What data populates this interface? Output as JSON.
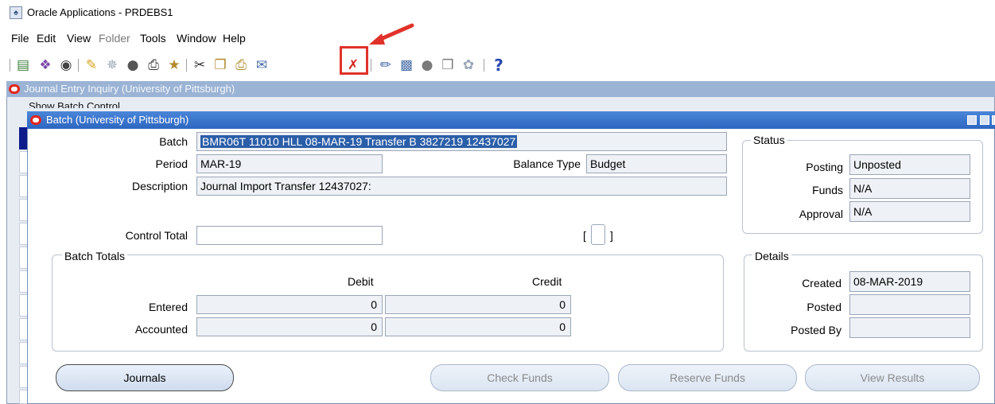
{
  "window": {
    "title": "Oracle Applications - PRDEBS1"
  },
  "menu": {
    "file": "File",
    "edit": "Edit",
    "view": "View",
    "folder": "Folder",
    "tools": "Tools",
    "window": "Window",
    "help": "Help"
  },
  "toolbar": {
    "icons": [
      "new-record-icon",
      "find-icon",
      "show-navigator-icon",
      "save-icon",
      "next-step-icon",
      "switch-responsibility-icon",
      "print-icon",
      "close-form-icon",
      "cut-icon",
      "copy-icon",
      "paste-icon",
      "clear-record-icon",
      "delete-record-icon",
      "edit-field-icon",
      "zoom-icon",
      "translations-icon",
      "attachments-icon",
      "folder-tools-icon",
      "help-icon"
    ],
    "highlighted": "delete-record-icon",
    "help_glyph": "?"
  },
  "bg_window": {
    "title": "Journal Entry Inquiry (University of Pittsburgh)",
    "show_batch_control": "Show Batch Control"
  },
  "batch_window": {
    "title": "Batch (University of Pittsburgh)",
    "batch_label": "Batch",
    "batch_value": "BMR06T 11010 HLL 08-MAR-19 Transfer B 3827219 12437027",
    "period_label": "Period",
    "period_value": "MAR-19",
    "balance_type_label": "Balance Type",
    "balance_type_value": "Budget",
    "description_label": "Description",
    "description_value": "Journal Import Transfer 12437027:",
    "control_total_label": "Control Total",
    "control_total_value": "",
    "dff_open": "[",
    "dff_close": "]",
    "status": {
      "title": "Status",
      "posting_label": "Posting",
      "posting_value": "Unposted",
      "funds_label": "Funds",
      "funds_value": "N/A",
      "approval_label": "Approval",
      "approval_value": "N/A"
    },
    "batch_totals": {
      "title": "Batch Totals",
      "debit_header": "Debit",
      "credit_header": "Credit",
      "entered_label": "Entered",
      "entered_debit": "0",
      "entered_credit": "0",
      "accounted_label": "Accounted",
      "accounted_debit": "0",
      "accounted_credit": "0"
    },
    "details": {
      "title": "Details",
      "created_label": "Created",
      "created_value": "08-MAR-2019",
      "posted_label": "Posted",
      "posted_value": "",
      "posted_by_label": "Posted By",
      "posted_by_value": ""
    },
    "buttons": {
      "journals": "Journals",
      "check_funds": "Check Funds",
      "reserve_funds": "Reserve Funds",
      "view_results": "View Results"
    }
  },
  "colors": {
    "title_active": "#2d66c0",
    "title_inactive": "#9bb3d4",
    "selection": "#2b5ea8",
    "highlight_box": "#e0322a"
  }
}
